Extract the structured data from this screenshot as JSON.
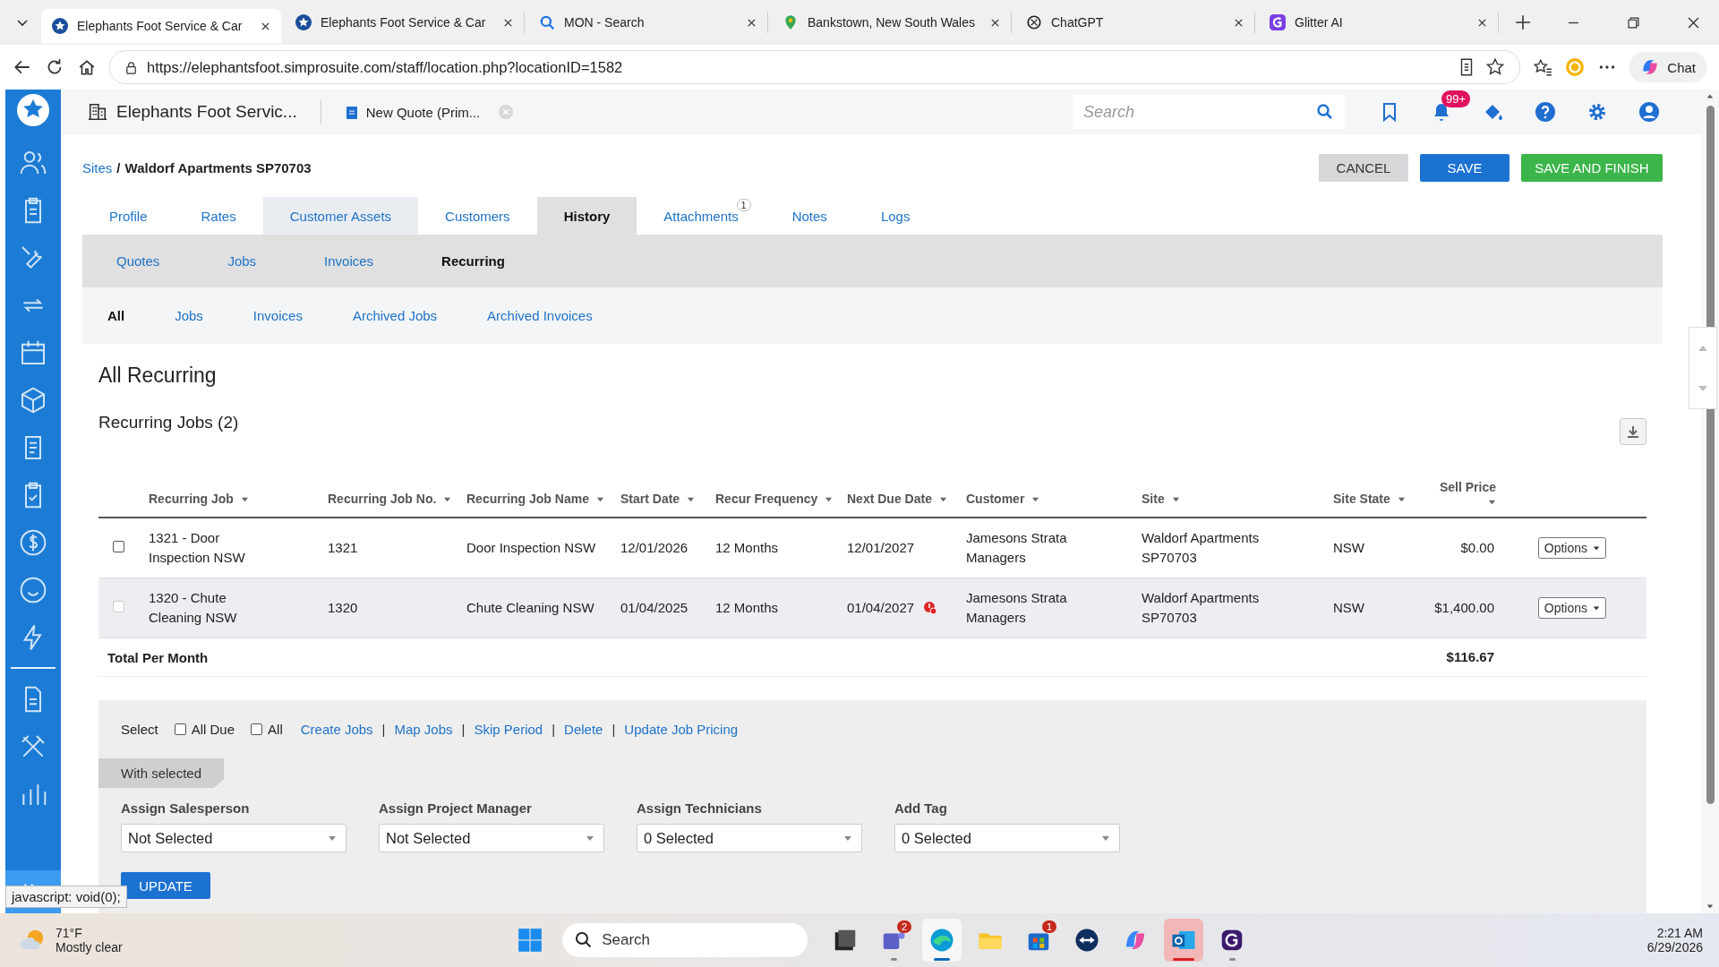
{
  "browser": {
    "tabs": [
      {
        "title": "Elephants Foot Service & Car",
        "selected": true
      },
      {
        "title": "Elephants Foot Service & Car",
        "selected": false
      },
      {
        "title": "MON - Search",
        "selected": false
      },
      {
        "title": "Bankstown, New South Wales",
        "selected": false
      },
      {
        "title": "ChatGPT",
        "selected": false
      },
      {
        "title": "Glitter AI",
        "selected": false
      }
    ],
    "url": "https://elephantsfoot.simprosuite.com/staff/location.php?locationID=1582",
    "chat_label": "Chat"
  },
  "header": {
    "company": "Elephants Foot Servic...",
    "open_tab": "New Quote (Prim...",
    "search_placeholder": "Search",
    "notification_count": "99+"
  },
  "breadcrumb": {
    "parent": "Sites",
    "separator": "/",
    "current": "Waldorf Apartments SP70703"
  },
  "actions": [
    {
      "label": "CANCEL",
      "kind": "secondary"
    },
    {
      "label": "SAVE",
      "kind": "primary"
    },
    {
      "label": "SAVE AND FINISH",
      "kind": "success"
    }
  ],
  "tabs": [
    {
      "label": "Profile",
      "selected": false,
      "hovered": false
    },
    {
      "label": "Rates",
      "selected": false,
      "hovered": false
    },
    {
      "label": "Customer Assets",
      "selected": false,
      "hovered": true
    },
    {
      "label": "Customers",
      "selected": false,
      "hovered": false
    },
    {
      "label": "History",
      "selected": true,
      "hovered": false
    },
    {
      "label": "Attachments",
      "selected": false,
      "hovered": false,
      "badge": "1"
    },
    {
      "label": "Notes",
      "selected": false,
      "hovered": false
    },
    {
      "label": "Logs",
      "selected": false,
      "hovered": false
    }
  ],
  "subtabs": [
    {
      "label": "Quotes",
      "selected": false
    },
    {
      "label": "Jobs",
      "selected": false
    },
    {
      "label": "Invoices",
      "selected": false
    },
    {
      "label": "Recurring",
      "selected": true
    }
  ],
  "filters": [
    {
      "label": "All",
      "selected": true
    },
    {
      "label": "Jobs",
      "selected": false
    },
    {
      "label": "Invoices",
      "selected": false
    },
    {
      "label": "Archived Jobs",
      "selected": false
    },
    {
      "label": "Archived Invoices",
      "selected": false
    }
  ],
  "title": "All Recurring",
  "section_title": "Recurring Jobs (2)",
  "table": {
    "columns": [
      "Recurring Job",
      "Recurring Job No.",
      "Recurring Job Name",
      "Start Date",
      "Recur Frequency",
      "Next Due Date",
      "Customer",
      "Site",
      "Site State",
      "Sell Price"
    ],
    "rows": [
      {
        "checked": false,
        "disabled": false,
        "highlighted": false,
        "alert": false,
        "cells": [
          "1321 - Door Inspection NSW",
          "1321",
          "Door Inspection NSW",
          "12/01/2026",
          "12 Months",
          "12/01/2027",
          "Jamesons Strata Managers",
          "Waldorf Apartments SP70703",
          "NSW",
          "$0.00"
        ],
        "action": "Options"
      },
      {
        "checked": false,
        "disabled": true,
        "highlighted": true,
        "alert": true,
        "cells": [
          "1320 - Chute Cleaning NSW",
          "1320",
          "Chute Cleaning NSW",
          "01/04/2025",
          "12 Months",
          "01/04/2027",
          "Jamesons Strata Managers",
          "Waldorf Apartments SP70703",
          "NSW",
          "$1,400.00"
        ],
        "action": "Options"
      }
    ],
    "total": {
      "label": "Total Per Month",
      "value": "$116.67"
    }
  },
  "bulk": {
    "select_label": "Select",
    "options": [
      {
        "label": "All Due",
        "checked": false
      },
      {
        "label": "All",
        "checked": false
      }
    ],
    "links": [
      "Create Jobs",
      "Map Jobs",
      "Skip Period",
      "Delete",
      "Update Job Pricing"
    ],
    "link_separator": "|",
    "with_selected": "With selected",
    "fields": [
      {
        "label": "Assign Salesperson",
        "value": "Not Selected"
      },
      {
        "label": "Assign Project Manager",
        "value": "Not Selected"
      },
      {
        "label": "Assign Technicians",
        "value": "0 Selected"
      },
      {
        "label": "Add Tag",
        "value": "0 Selected"
      }
    ],
    "submit": "UPDATE"
  },
  "status_tooltip": "javascript: void(0);",
  "taskbar": {
    "weather": {
      "temp": "71°F",
      "condition": "Mostly clear"
    },
    "search_placeholder": "Search",
    "apps": [
      {
        "kind": "taskview",
        "running": false,
        "active": false,
        "flashing": false
      },
      {
        "kind": "teams",
        "running": true,
        "active": false,
        "flashing": false,
        "badge": "2"
      },
      {
        "kind": "edge",
        "running": true,
        "active": true,
        "flashing": false
      },
      {
        "kind": "explorer",
        "running": false,
        "active": false,
        "flashing": false
      },
      {
        "kind": "store",
        "running": false,
        "active": false,
        "flashing": false,
        "badge": "1"
      },
      {
        "kind": "teamviewer",
        "running": false,
        "active": false,
        "flashing": false
      },
      {
        "kind": "copilot",
        "running": false,
        "active": false,
        "flashing": false
      },
      {
        "kind": "outlook",
        "running": true,
        "active": false,
        "flashing": true
      },
      {
        "kind": "glitter",
        "running": true,
        "active": false,
        "flashing": false
      }
    ],
    "time": "2:21 AM",
    "date": "6/29/2026"
  }
}
